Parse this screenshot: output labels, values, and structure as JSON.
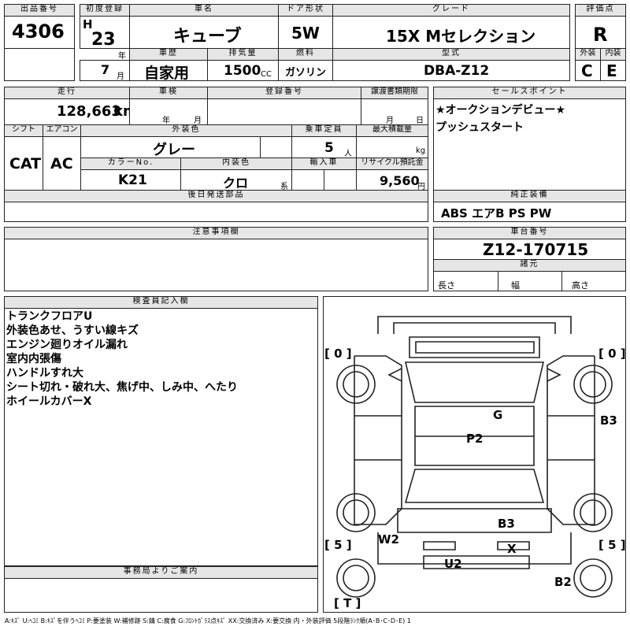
{
  "labels": {
    "lot_no": "出品番号",
    "first_reg": "初度登録",
    "car_name": "車名",
    "door": "ドア形状",
    "grade": "グレード",
    "score": "評価点",
    "history": "車歴",
    "displacement": "排気量",
    "fuel": "燃料",
    "model": "型式",
    "ext_score": "外装",
    "int_score": "内装",
    "mileage": "走行",
    "inspection": "車検",
    "reg_no": "登録番号",
    "transfer_deadline": "譲渡書類期限",
    "sales_point": "セールスポイント",
    "shift": "シフト",
    "aircon": "エアコン",
    "ext_color": "外装色",
    "capacity": "乗車定員",
    "max_load": "最大積載量",
    "color_no": "カラーNo.",
    "int_color": "内装色",
    "import": "輸入車",
    "recycle": "リサイクル預託金",
    "later_parts": "後日発送部品",
    "genuine_equip": "純正装備",
    "notes": "注意事項欄",
    "chassis_no": "車台番号",
    "specs": "諸元",
    "length": "長さ",
    "width": "幅",
    "height": "高さ",
    "inspector_notes": "検査員記入欄",
    "office_notice": "事務局よりご案内",
    "year_unit": "年",
    "month_unit": "月",
    "cc_unit": "CC",
    "km_unit": "km",
    "person_unit": "人",
    "kg_unit": "kg",
    "yen_unit": "円",
    "kei_unit": "系",
    "era": "H"
  },
  "vehicle": {
    "lot_no": "4306",
    "reg_year": "23",
    "reg_month": "7",
    "car_name": "キューブ",
    "door": "5W",
    "grade": "15X Mセレクション",
    "score": "R",
    "history": "自家用",
    "displacement": "1500",
    "fuel": "ガソリン",
    "model": "DBA-Z12",
    "ext_score": "C",
    "int_score": "E",
    "mileage": "128,663",
    "shift": "CAT",
    "aircon": "AC",
    "ext_color": "グレー",
    "capacity": "5",
    "color_no": "K21",
    "int_color": "クロ",
    "recycle": "9,560",
    "chassis_no": "Z12-170715"
  },
  "sales_points": [
    "★オークションデビュー★",
    "プッシュスタート"
  ],
  "genuine_equipment": "ABS エアB PS PW",
  "inspector_lines": [
    "トランクフロアU",
    "外装色あせ、うすい線キズ",
    "エンジン廻りオイル漏れ",
    "室内内張傷",
    "ハンドルすれ大",
    "シート切れ・破れ大、焦げ中、しみ中、へたり",
    "ホイールカバーX"
  ],
  "diagram": {
    "tire_fl": "[ 0 ]",
    "tire_fr": "[ 0 ]",
    "tire_rl": "[ 5 ]",
    "tire_rr": "[ 5 ]",
    "spare": "[ T ]",
    "marks": {
      "g": "G",
      "p2": "P2",
      "b3_right": "B3",
      "b3_rear": "B3",
      "w2": "W2",
      "x": "X",
      "u2": "U2",
      "b2": "B2"
    }
  },
  "legend": "A:ｷｽﾞ U:ﾍｺﾐ B:ｷｽﾞを伴うﾍｺﾐ P:要塗装 W:補修跡 S:錆 C:腐食 G:ﾌﾛﾝﾄｶﾞﾗｽ点ｷｽﾞ XX:交換済み X:要交換 内・外装評価 5段階ﾗﾝｸ順(A･B･C･D･E) 1"
}
